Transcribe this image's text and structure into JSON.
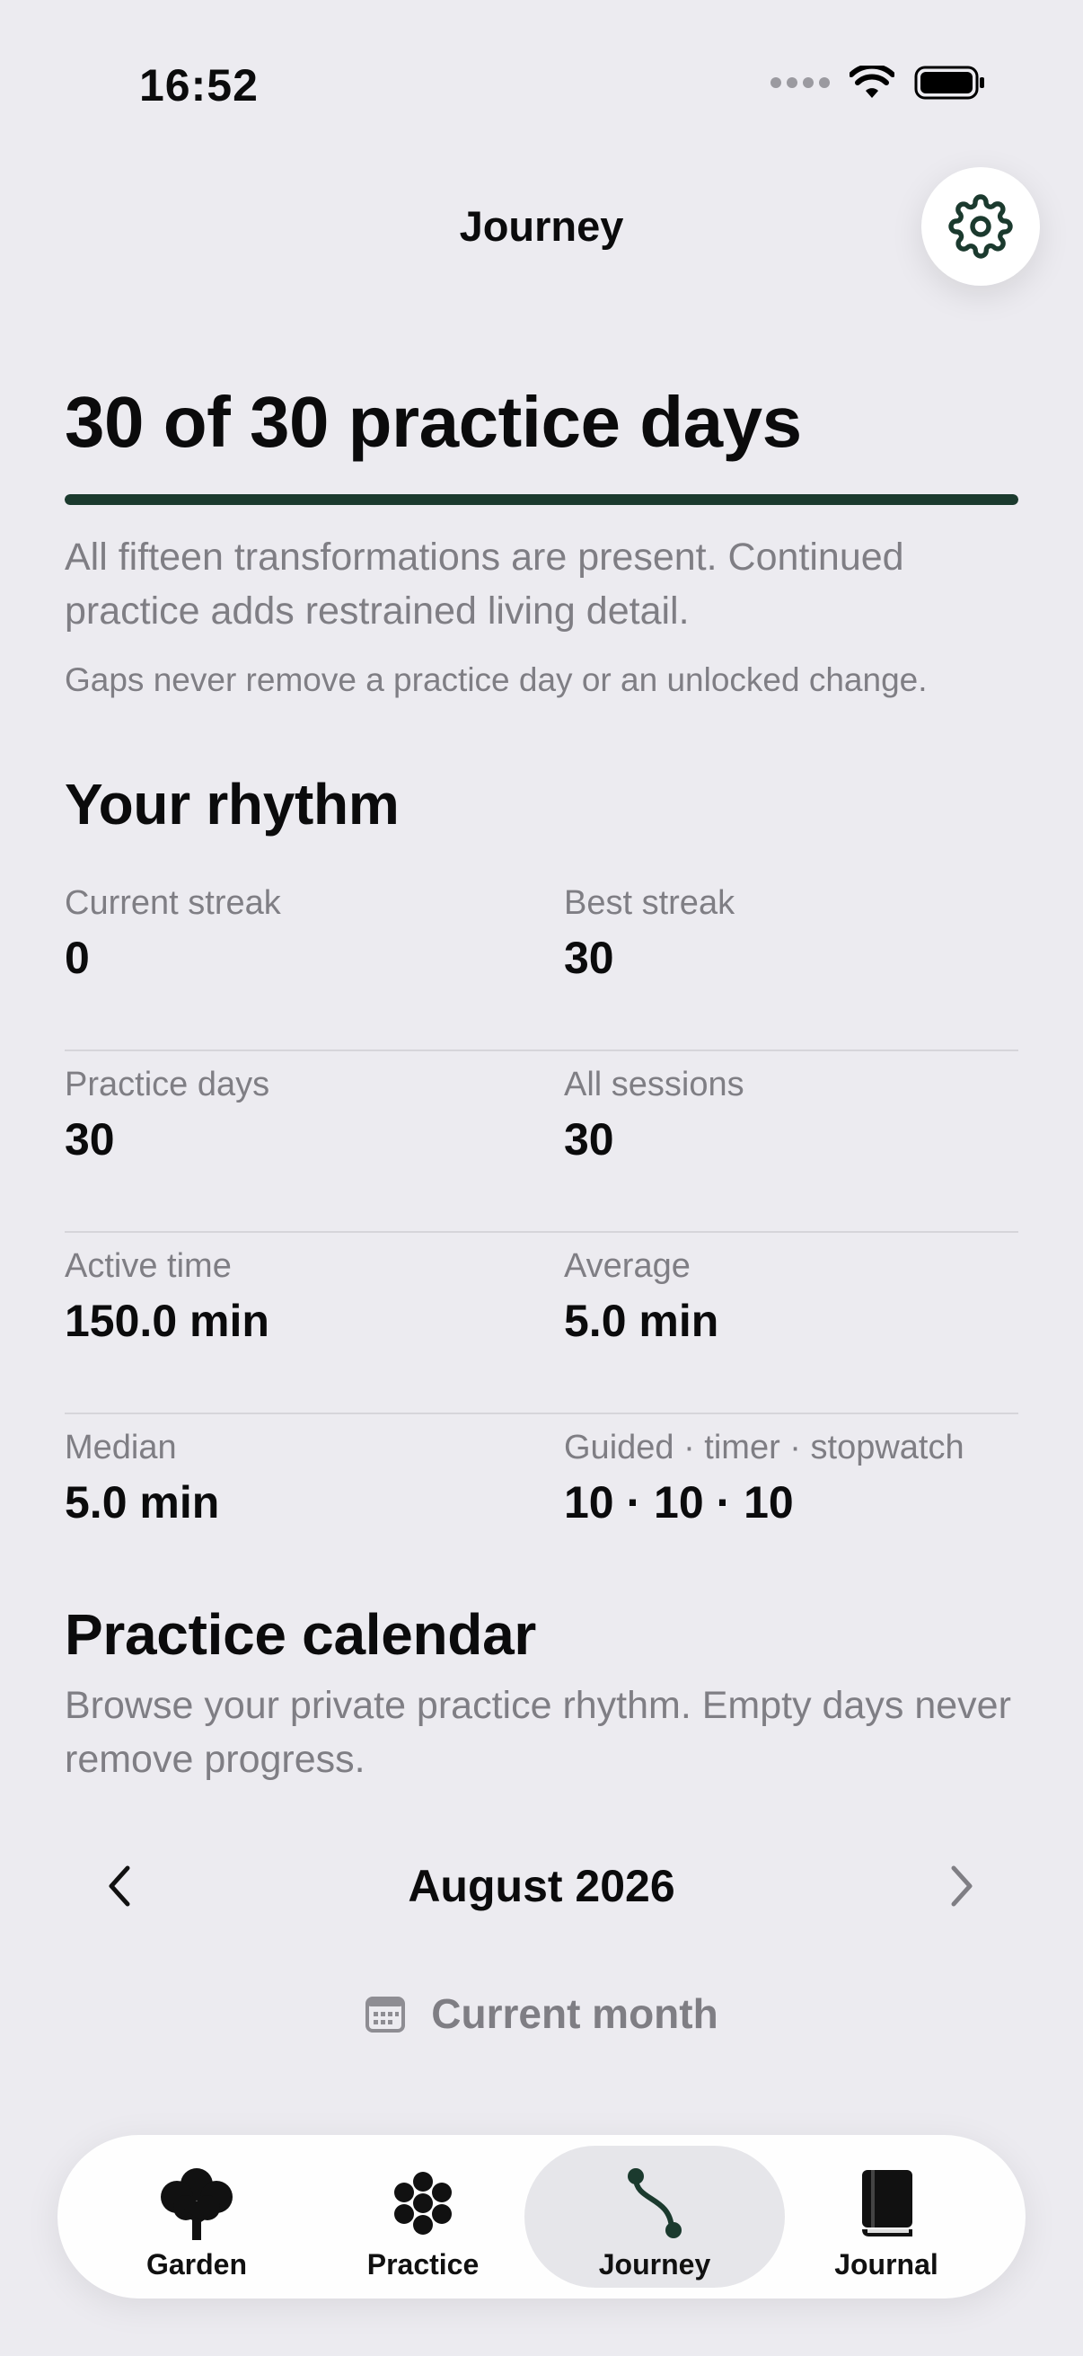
{
  "status_bar": {
    "time": "16:52"
  },
  "header": {
    "title": "Journey"
  },
  "hero": {
    "title": "30 of 30 practice days",
    "progress_fraction": 1.0,
    "description": "All fifteen transformations are present. Continued practice adds restrained living detail.",
    "note": "Gaps never remove a practice day or an unlocked change."
  },
  "rhythm": {
    "title": "Your rhythm",
    "rows": [
      [
        {
          "label": "Current streak",
          "value": "0"
        },
        {
          "label": "Best streak",
          "value": "30"
        }
      ],
      [
        {
          "label": "Practice days",
          "value": "30"
        },
        {
          "label": "All sessions",
          "value": "30"
        }
      ],
      [
        {
          "label": "Active time",
          "value": "150.0 min"
        },
        {
          "label": "Average",
          "value": "5.0 min"
        }
      ],
      [
        {
          "label": "Median",
          "value": "5.0 min"
        },
        {
          "label": "Guided · timer · stopwatch",
          "value": "10 · 10 · 10"
        }
      ]
    ]
  },
  "calendar": {
    "title": "Practice calendar",
    "description": "Browse your private practice rhythm. Empty days never remove progress.",
    "month": "August 2026",
    "current_month_label": "Current month"
  },
  "tabbar": {
    "tabs": [
      {
        "label": "Garden",
        "icon": "tree-icon",
        "active": false
      },
      {
        "label": "Practice",
        "icon": "flower-icon",
        "active": false
      },
      {
        "label": "Journey",
        "icon": "path-icon",
        "active": true
      },
      {
        "label": "Journal",
        "icon": "book-icon",
        "active": false
      }
    ]
  },
  "colors": {
    "background": "#ecebf0",
    "accent": "#1b3a2e",
    "secondary_text": "#7f7e84"
  }
}
